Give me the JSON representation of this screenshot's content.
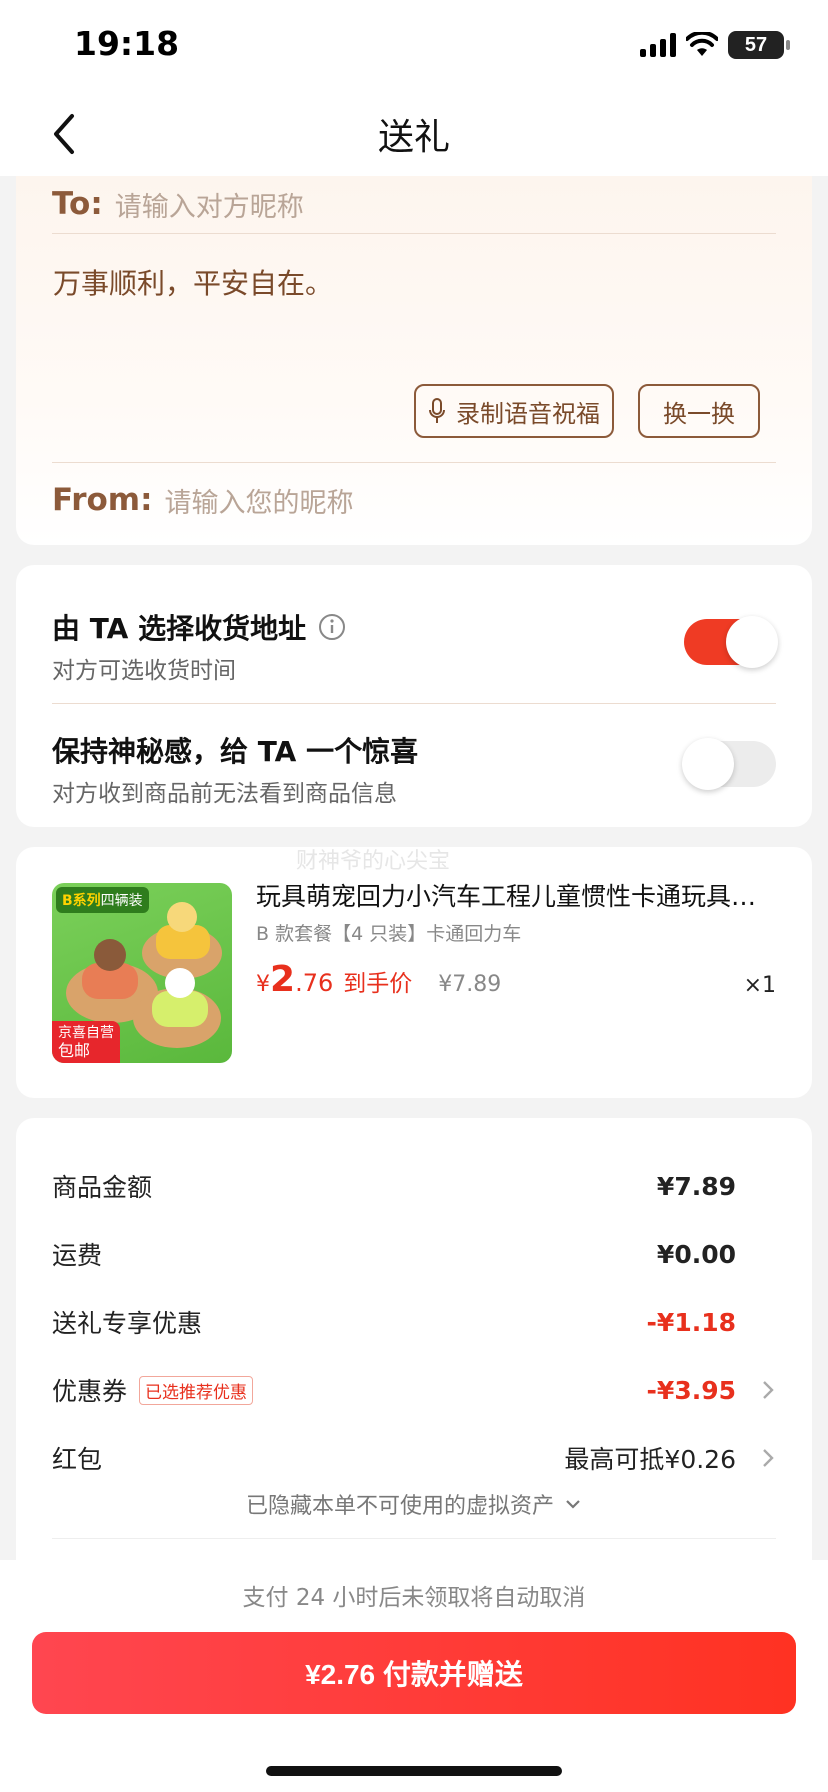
{
  "status_bar": {
    "time": "19:18",
    "battery": "57"
  },
  "nav": {
    "title": "送礼"
  },
  "greeting_card": {
    "to_label": "To:",
    "to_placeholder": "请输入对方昵称",
    "message": "万事顺利，平安自在。",
    "voice_button": "录制语音祝福",
    "change_button": "换一换",
    "from_label": "From:",
    "from_placeholder": "请输入您的昵称"
  },
  "options": [
    {
      "title": "由 TA 选择收货地址",
      "subtitle": "对方可选收货时间",
      "enabled": true
    },
    {
      "title": "保持神秘感，给 TA 一个惊喜",
      "subtitle": "对方收到商品前无法看到商品信息",
      "enabled": false
    }
  ],
  "product": {
    "watermark": "财神爷的心尖宝",
    "image_tag_series": "B系列",
    "image_tag_pack": "四辆装",
    "image_badge_line1": "京喜自营",
    "image_badge_line2": "包邮",
    "title": "玩具萌宠回力小汽车工程儿童惯性卡通玩具…",
    "spec": "B 款套餐【4 只装】卡通回力车",
    "price_symbol": "¥",
    "price_int": "2",
    "price_dec": ".76",
    "price_label": "到手价",
    "original_price": "¥7.89",
    "quantity": "×1"
  },
  "summary": {
    "rows": [
      {
        "label": "商品金额",
        "value": "¥7.89"
      },
      {
        "label": "运费",
        "value": "¥0.00"
      },
      {
        "label": "送礼专享优惠",
        "value": "-¥1.18"
      },
      {
        "label": "优惠券",
        "tag": "已选推荐优惠",
        "value": "-¥3.95"
      },
      {
        "label": "红包",
        "value": "最高可抵¥0.26"
      }
    ],
    "hidden_assets": "已隐藏本单不可使用的虚拟资产"
  },
  "bottom": {
    "notice": "支付 24 小时后未领取将自动取消",
    "pay_button": "¥2.76 付款并赠送"
  },
  "colors": {
    "accent_red": "#e8301d",
    "brown": "#8c5a3a",
    "toggle_on": "#ef3b24"
  }
}
